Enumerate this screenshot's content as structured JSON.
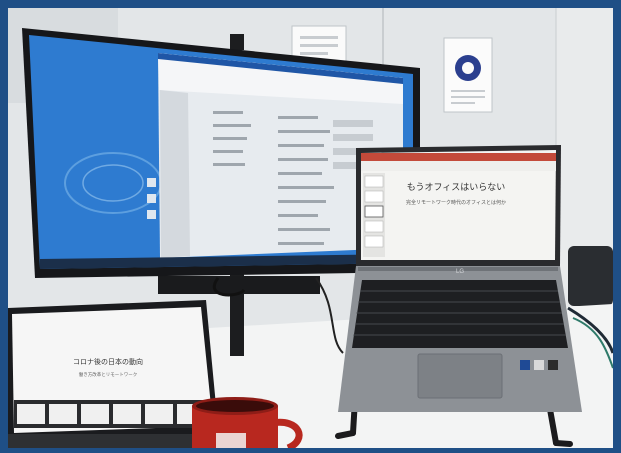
{
  "laptop_slide": {
    "title": "もうオフィスはいらない",
    "subtitle": "完全リモートワーク時代のオフィスとは何か"
  },
  "tablet_slide": {
    "title": "コロナ後の日本の動向",
    "subtitle": "働き方改革とリモートワーク"
  },
  "laptop_brand": "LG"
}
